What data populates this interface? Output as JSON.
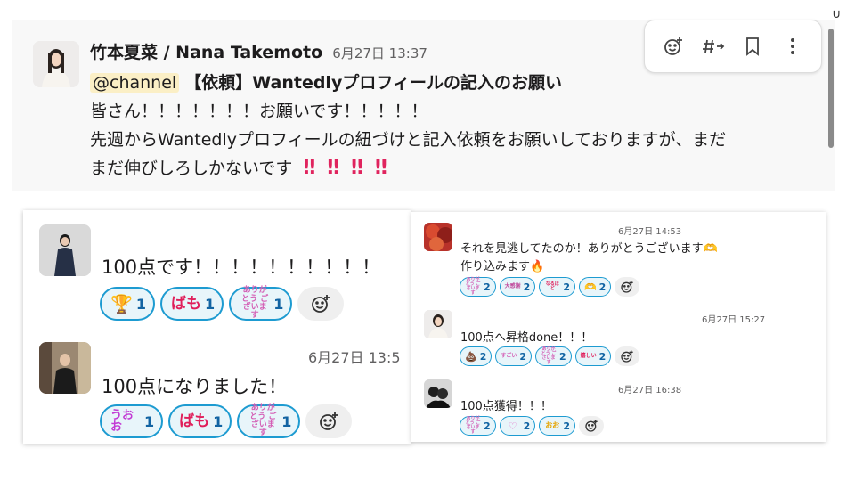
{
  "top_message": {
    "sender": "竹本夏菜 / Nana Takemoto",
    "time": "6月27日 13:37",
    "mention": "@channel",
    "title": "【依頼】Wantedlyプロフィールの記入のお願い",
    "line2": "皆さん！！！！！！！お願いです！！！！！",
    "line3": "先週からWantedlyプロフィールの紐づけと記入依頼をお願いしておりますが、まだ",
    "line4": "まだ伸びしろしかないです",
    "bang_mark": "‼"
  },
  "message_actions": {
    "icons": [
      "add-reaction-icon",
      "share-to-channel-icon",
      "bookmark-icon",
      "more-icon"
    ]
  },
  "corner_glyph": "∪",
  "left_panel": {
    "messages": [
      {
        "text": "100点です！！！！！！！！！！",
        "reactions": [
          {
            "icon": "trophy-emoji",
            "glyph": "🏆",
            "count": "1"
          },
          {
            "icon": "bamo-stamp-emoji",
            "label": "ばも",
            "color": "#e01e5a",
            "count": "1"
          },
          {
            "icon": "arigatou-stamp-emoji",
            "label": "ありがとう ございます",
            "color": "#d45fb5",
            "count": "1"
          }
        ]
      },
      {
        "time": "6月27日 13:5",
        "text": "100点になりました！",
        "reactions": [
          {
            "icon": "uooo-stamp-emoji",
            "label": "うおお",
            "color": "#c23bd4",
            "count": "1"
          },
          {
            "icon": "bamo-stamp-emoji",
            "label": "ばも",
            "color": "#e01e5a",
            "count": "1"
          },
          {
            "icon": "arigatou-stamp-emoji",
            "label": "ありがとう ございます",
            "color": "#d45fb5",
            "count": "1"
          }
        ]
      }
    ]
  },
  "right_panel": {
    "messages": [
      {
        "time": "6月27日 14:53",
        "text1": "それを見逃してたのか！ありがとうございます🫶",
        "text2": "作り込みます🔥",
        "reactions": [
          {
            "icon": "arigatou-stamp-emoji",
            "label": "ありがとう ございます",
            "color": "#d45fb5",
            "count": "2"
          },
          {
            "icon": "daikansha-stamp-emoji",
            "label": "大感謝",
            "color": "#c04a9c",
            "count": "2"
          },
          {
            "icon": "naruhodo-stamp-emoji",
            "label": "なるほど",
            "color": "#e01e5a",
            "count": "2"
          },
          {
            "icon": "heart-hands-emoji",
            "glyph": "🫶",
            "count": "2"
          }
        ]
      },
      {
        "time": "6月27日 15:27",
        "text1": "100点へ昇格done！！！",
        "reactions": [
          {
            "icon": "poop-emoji",
            "glyph": "💩",
            "count": "2"
          },
          {
            "icon": "sugoi-stamp-emoji",
            "label": "すごい",
            "color": "#d45fb5",
            "count": "2"
          },
          {
            "icon": "arigatou-stamp-emoji",
            "label": "ありがとう ございます",
            "color": "#d45fb5",
            "count": "2"
          },
          {
            "icon": "ureshii-stamp-emoji",
            "label": "嬉しい",
            "color": "#e01e5a",
            "count": "2"
          }
        ]
      },
      {
        "time": "6月27日 16:38",
        "text1": "100点獲得！！！",
        "reactions": [
          {
            "icon": "arigatou-stamp-emoji",
            "label": "ありがとう ございます",
            "color": "#d45fb5",
            "count": "2"
          },
          {
            "icon": "heart-stamp-emoji",
            "label": "♡",
            "color": "#e36fc7",
            "count": "2"
          },
          {
            "icon": "ooo-stamp-emoji",
            "label": "おお",
            "color": "#e6a400",
            "count": "2"
          }
        ]
      }
    ]
  },
  "colors": {
    "accent": "#1d9bd1",
    "reaction_bg": "#e8f5fa",
    "mention_bg": "#fbefc6",
    "bang": "#e0245e"
  }
}
